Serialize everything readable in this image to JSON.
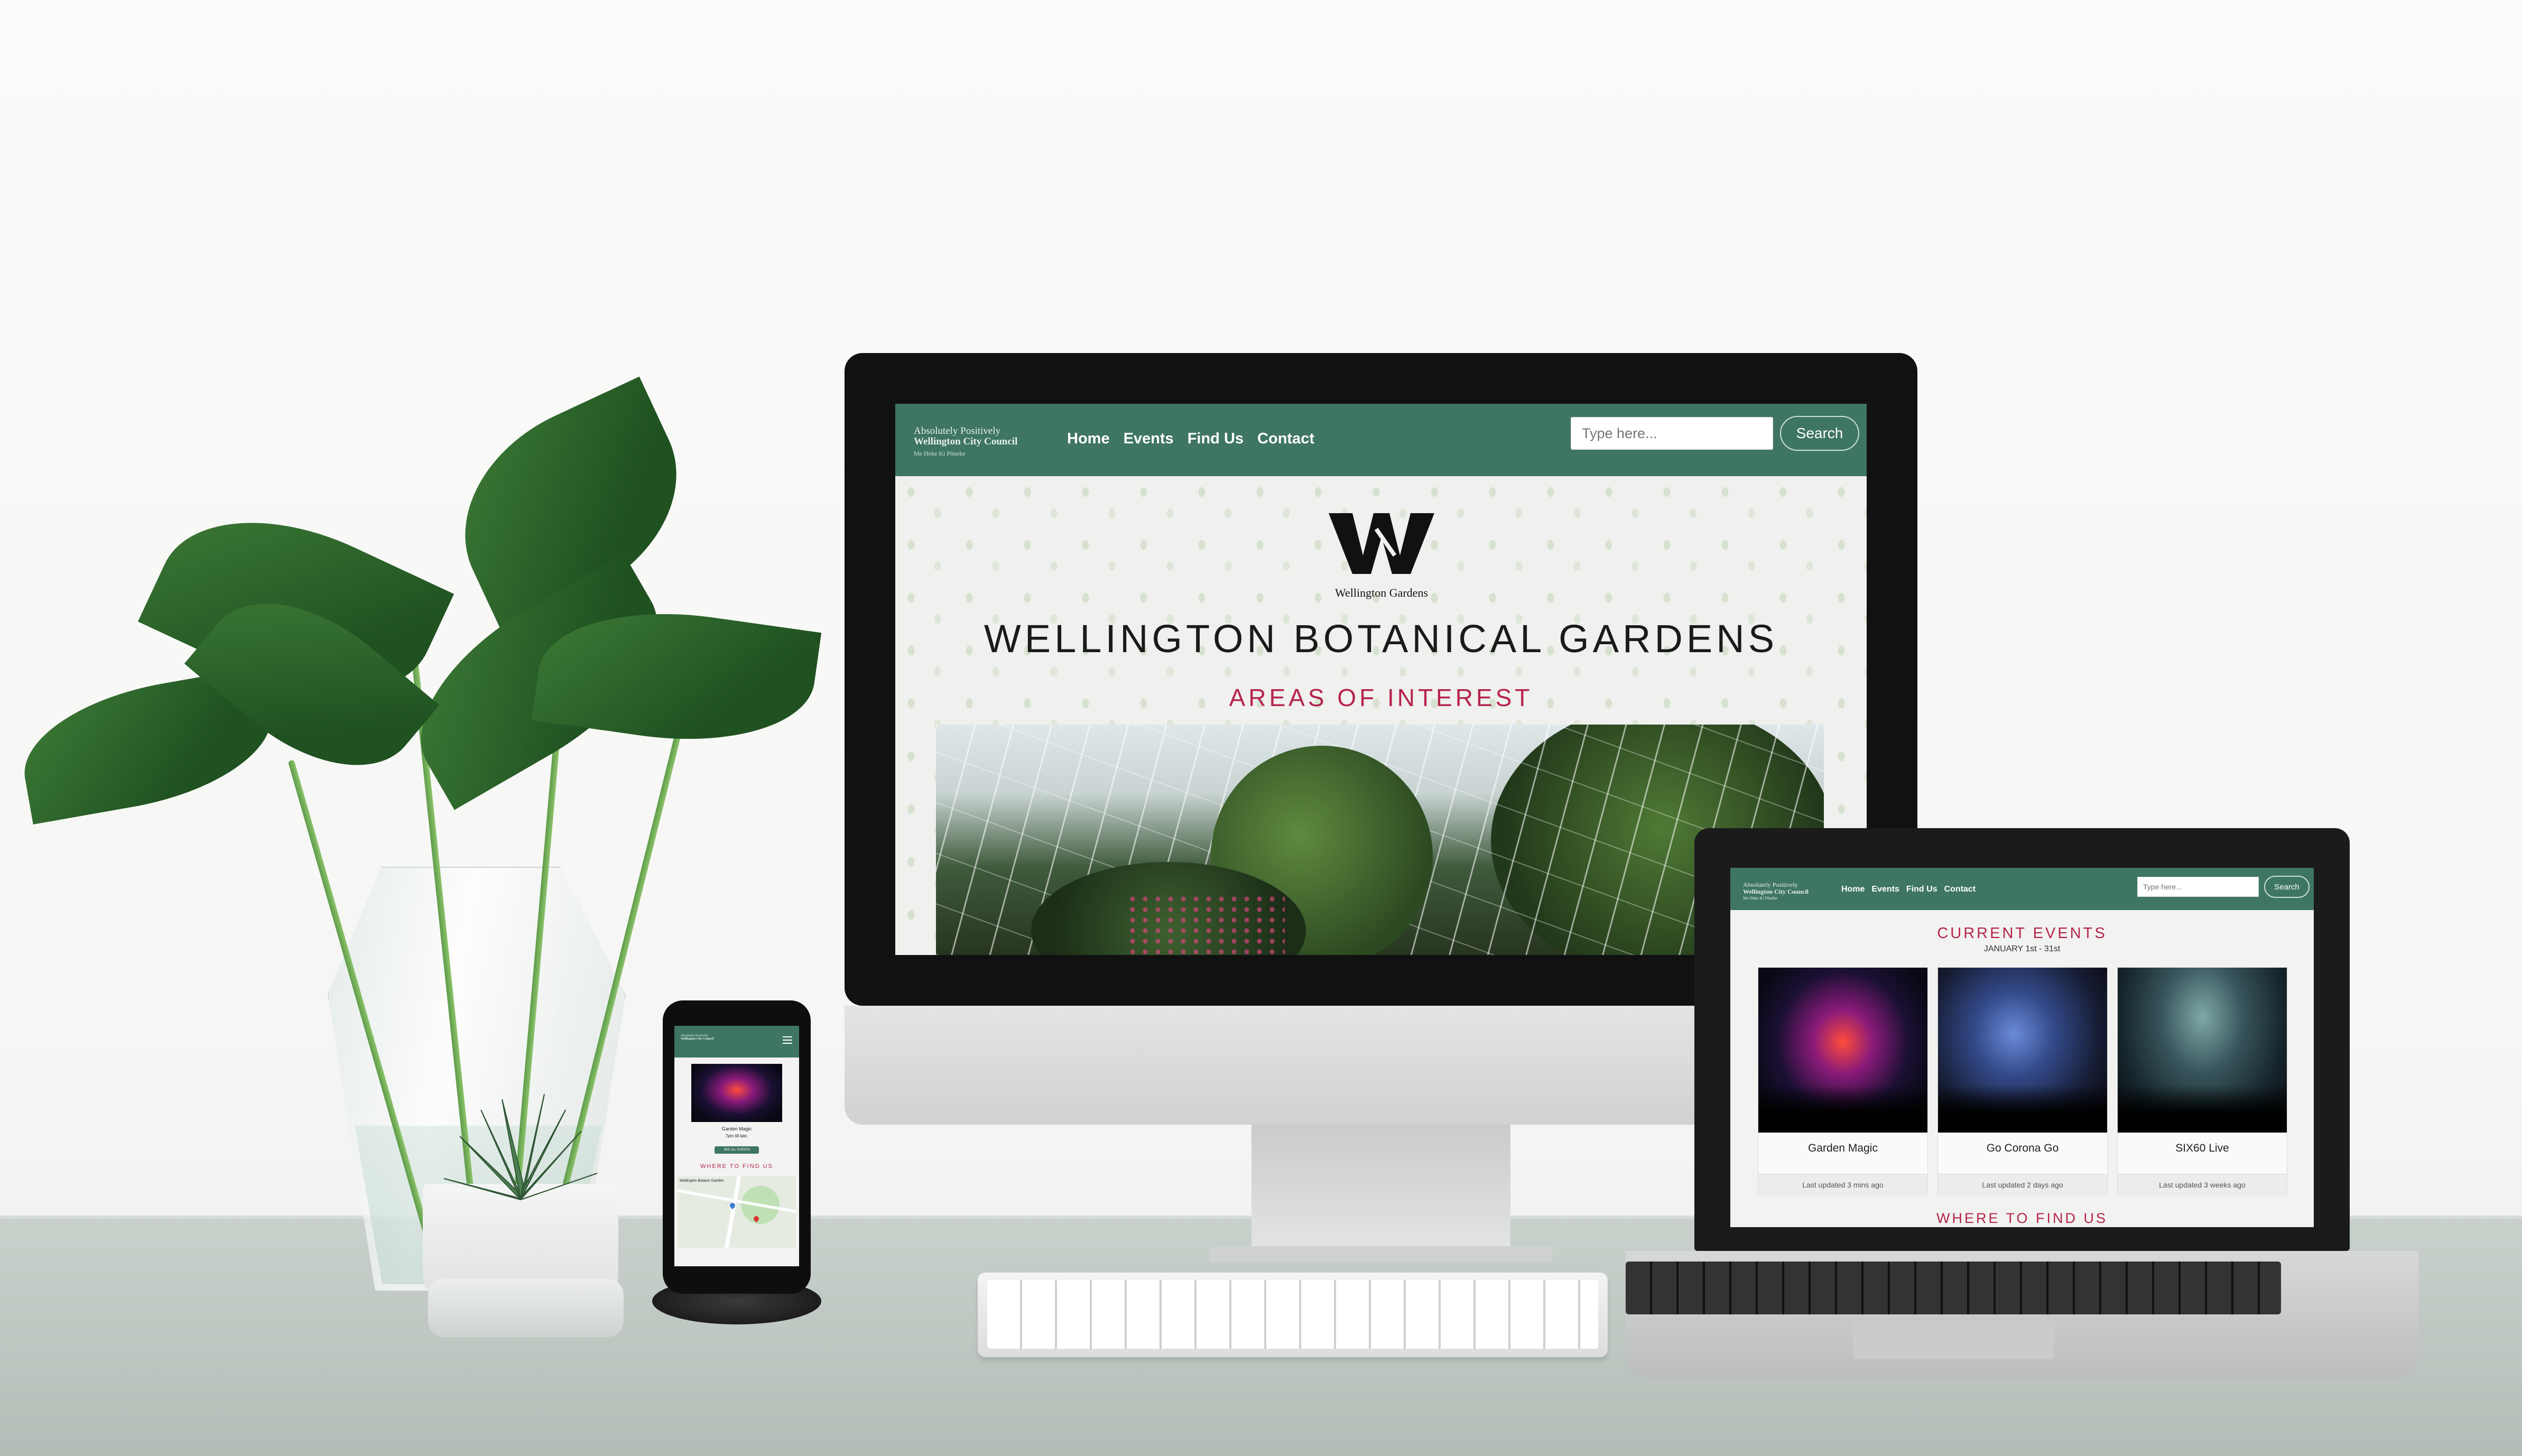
{
  "desktop": {
    "header": {
      "council_line1": "Absolutely Positively",
      "council_line2": "Wellington City Council",
      "council_line3": "Me Heke Ki Pōneke",
      "nav": [
        "Home",
        "Events",
        "Find Us",
        "Contact"
      ],
      "search_placeholder": "Type here...",
      "search_button": "Search"
    },
    "hero": {
      "logo_caption": "Wellington Gardens",
      "title": "WELLINGTON BOTANICAL GARDENS",
      "section_heading": "AREAS OF INTEREST"
    }
  },
  "laptop": {
    "header": {
      "council_line1": "Absolutely Positively",
      "council_line2": "Wellington City Council",
      "council_line3": "Me Heke Ki Pōneke",
      "nav": [
        "Home",
        "Events",
        "Find Us",
        "Contact"
      ],
      "search_placeholder": "Type here...",
      "search_button": "Search"
    },
    "events_heading": "CURRENT EVENTS",
    "events_dates": "JANUARY 1st - 31st",
    "events": [
      {
        "name": "Garden Magic",
        "updated": "Last updated 3 mins ago"
      },
      {
        "name": "Go Corona Go",
        "updated": "Last updated 2 days ago"
      },
      {
        "name": "SIX60 Live",
        "updated": "Last updated 3 weeks ago"
      }
    ],
    "where_heading": "WHERE TO FIND US"
  },
  "phone": {
    "council_line1": "Absolutely Positively",
    "council_line2": "Wellington City Council",
    "event_name": "Garden Magic",
    "event_time": "7pm till late.",
    "button": "SEE ALL EVENTS",
    "where_heading": "WHERE TO FIND US",
    "map_label": "Wellington Botanic Garden"
  },
  "colors": {
    "header_green": "#3e7564",
    "accent_crimson": "#b52350"
  }
}
